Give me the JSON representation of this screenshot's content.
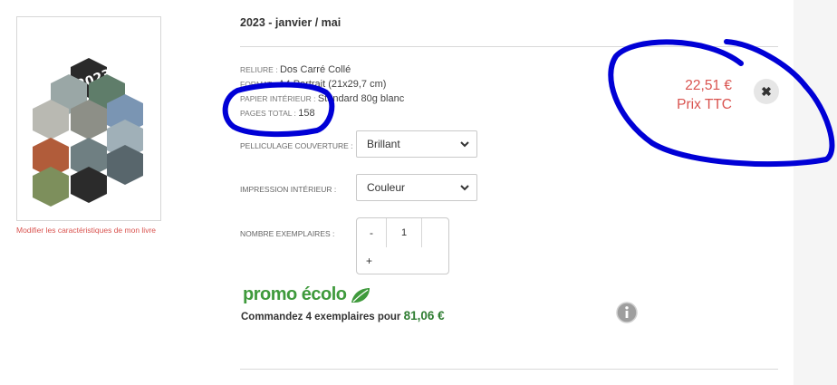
{
  "cover": {
    "year_text": "2023",
    "modify_link": "Modifier les caractéristiques de mon livre"
  },
  "product": {
    "title": "2023 - janvier / mai"
  },
  "specs": [
    {
      "key": "RELIURE",
      "value": "Dos Carré Collé"
    },
    {
      "key": "FORMAT",
      "value": "A4 Portrait (21x29,7 cm)"
    },
    {
      "key": "PAPIER INTÉRIEUR",
      "value": "Standard 80g blanc"
    },
    {
      "key": "PAGES TOTAL",
      "value": "158"
    }
  ],
  "options": {
    "cover_label": "PELLICULAGE COUVERTURE :",
    "cover_value": "Brillant",
    "print_label": "IMPRESSION INTÉRIEUR :",
    "print_value": "Couleur",
    "qty_label": "NOMBRE EXEMPLAIRES :",
    "qty_minus": "-",
    "qty_value": "1",
    "qty_plus": "+"
  },
  "promo": {
    "brand": "promo",
    "brand2": "écolo",
    "text": "Commandez 4 exemplaires pour",
    "price": "81,06 €"
  },
  "price": {
    "amount": "22,51 €",
    "note": "Prix TTC"
  },
  "close_symbol": "✖",
  "colors": {
    "accent_red": "#d9534f",
    "promo_green": "#3f9a3c",
    "annotation_blue": "#0000d6"
  },
  "icons": [
    "chevron-down-icon",
    "leaf-icon",
    "info-icon",
    "close-icon"
  ]
}
